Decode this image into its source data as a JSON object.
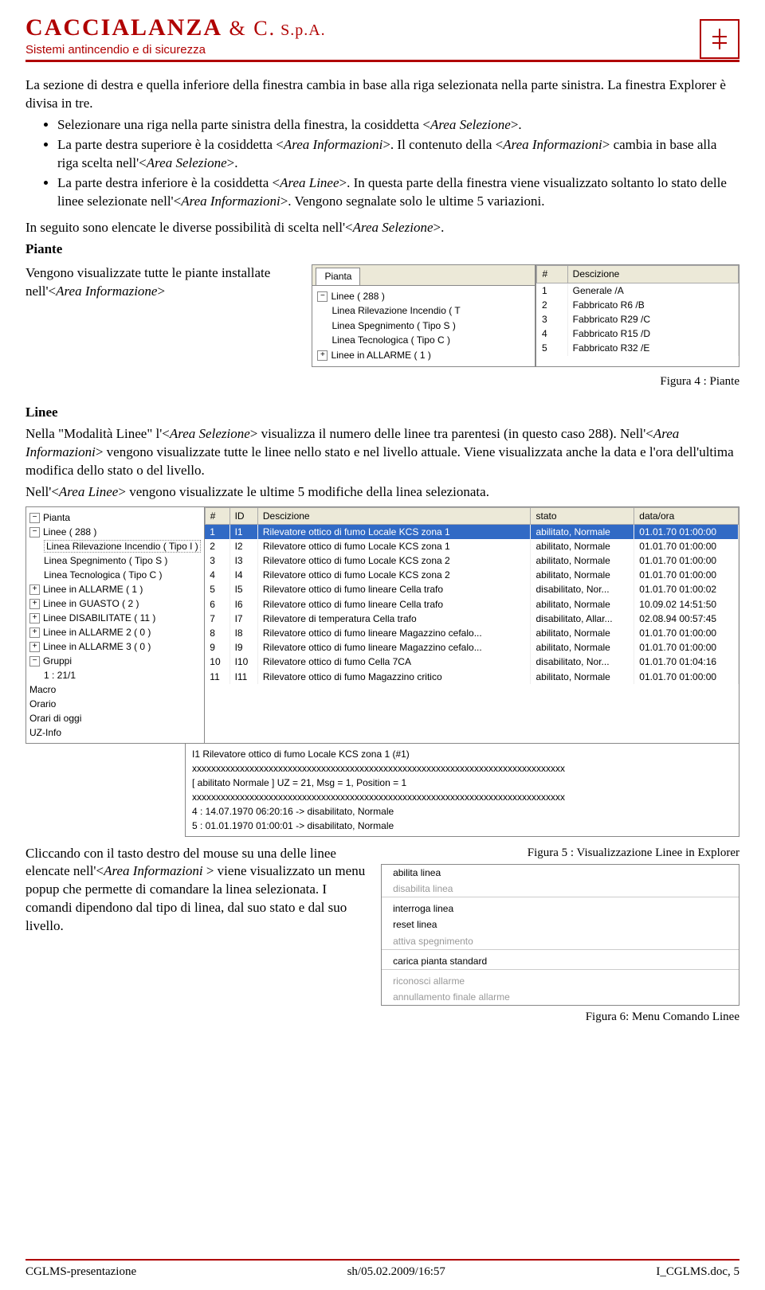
{
  "header": {
    "company": "CACCIALANZA",
    "amp": " & C.",
    "spa": " S.p.A.",
    "tagline": "Sistemi antincendio e di sicurezza",
    "logo": "⌘"
  },
  "p1": "La sezione di destra e quella inferiore della finestra cambia in base alla riga selezionata nella parte sinistra. La finestra Explorer è divisa in tre.",
  "b1a": "Selezionare una riga nella parte sinistra della finestra, la cosiddetta <",
  "b1b": "Area Selezione",
  "b1c": ">.",
  "b2a": "La parte destra superiore è la cosiddetta <",
  "b2b": "Area Informazioni",
  "b2c": ">. Il contenuto della <",
  "b2d": "Area Informazioni",
  "b2e": "> cambia in base alla riga scelta nell'<",
  "b2f": "Area Selezione",
  "b2g": ">.",
  "b3a": "La parte destra inferiore è la cosiddetta <",
  "b3b": "Area Linee",
  "b3c": ">. In questa parte della finestra viene visualizzato soltanto lo stato delle linee selezionate nell'<",
  "b3d": "Area Informazioni",
  "b3e": ">. Vengono segnalate solo le ultime 5 variazioni.",
  "p2a": "In seguito sono elencate le diverse possibilità di scelta nell'<",
  "p2b": "Area Selezione",
  "p2c": ">.",
  "piante": "Piante",
  "p3a": "Vengono visualizzate tutte le piante installate nell'<",
  "p3b": "Area Informazione",
  "p3c": ">",
  "fig4": "Figura 4 : Piante",
  "tree1": {
    "tab": "Pianta",
    "items": [
      "Linee ( 288 )",
      "Linea Rilevazione Incendio ( T",
      "Linea Spegnimento ( Tipo S )",
      "Linea Tecnologica ( Tipo C )",
      "Linee in ALLARME ( 1 )"
    ]
  },
  "tbl1": {
    "h": [
      "#",
      "Descizione"
    ],
    "r": [
      [
        "1",
        "Generale /A"
      ],
      [
        "2",
        "Fabbricato R6 /B"
      ],
      [
        "3",
        "Fabbricato R29 /C"
      ],
      [
        "4",
        "Fabbricato R15 /D"
      ],
      [
        "5",
        "Fabbricato R32 /E"
      ]
    ]
  },
  "linee": "Linee",
  "p4a": "Nella \"Modalità Linee\" l'<",
  "p4b": "Area Selezione",
  "p4c": "> visualizza il numero delle linee tra parentesi (in questo caso 288). Nell'<",
  "p4d": "Area Informazioni",
  "p4e": "> vengono visualizzate tutte le linee nello stato e nel livello attuale. Viene visualizzata anche la data e l'ora dell'ultima modifica dello stato o del livello.",
  "p5a": "Nell'<",
  "p5b": "Area Linee",
  "p5c": "> vengono visualizzate le ultime 5 modifiche della linea selezionata.",
  "tree2": [
    "Pianta",
    "Linee ( 288 )",
    "Linea Rilevazione Incendio ( Tipo I )",
    "Linea Spegnimento ( Tipo S )",
    "Linea Tecnologica ( Tipo C )",
    "Linee in ALLARME ( 1 )",
    "Linee in GUASTO ( 2 )",
    "Linee DISABILITATE ( 11 )",
    "Linee in ALLARME 2 ( 0 )",
    "Linee in ALLARME 3 ( 0 )",
    "Gruppi",
    "1 : 21/1",
    "Macro",
    "Orario",
    "Orari di oggi",
    "UZ-Info"
  ],
  "tbl2": {
    "h": [
      "#",
      "ID",
      "Descizione",
      "stato",
      "data/ora"
    ],
    "r": [
      [
        "1",
        "I1",
        "Rilevatore ottico di fumo Locale KCS zona 1",
        "abilitato, Normale",
        "01.01.70 01:00:00"
      ],
      [
        "2",
        "I2",
        "Rilevatore ottico di fumo Locale KCS zona 1",
        "abilitato, Normale",
        "01.01.70 01:00:00"
      ],
      [
        "3",
        "I3",
        "Rilevatore ottico di fumo Locale KCS zona 2",
        "abilitato, Normale",
        "01.01.70 01:00:00"
      ],
      [
        "4",
        "I4",
        "Rilevatore ottico di fumo Locale KCS zona 2",
        "abilitato, Normale",
        "01.01.70 01:00:00"
      ],
      [
        "5",
        "I5",
        "Rilevatore ottico di fumo lineare Cella trafo",
        "disabilitato, Nor...",
        "01.01.70 01:00:02"
      ],
      [
        "6",
        "I6",
        "Rilevatore ottico di fumo lineare Cella trafo",
        "abilitato, Normale",
        "10.09.02 14:51:50"
      ],
      [
        "7",
        "I7",
        "Rilevatore di temperatura Cella trafo",
        "disabilitato, Allar...",
        "02.08.94 00:57:45"
      ],
      [
        "8",
        "I8",
        "Rilevatore ottico di fumo lineare Magazzino cefalo...",
        "abilitato, Normale",
        "01.01.70 01:00:00"
      ],
      [
        "9",
        "I9",
        "Rilevatore ottico di fumo lineare Magazzino cefalo...",
        "abilitato, Normale",
        "01.01.70 01:00:00"
      ],
      [
        "10",
        "I10",
        "Rilevatore ottico di fumo Cella 7CA",
        "disabilitato, Nor...",
        "01.01.70 01:04:16"
      ],
      [
        "11",
        "I11",
        "Rilevatore ottico di fumo Magazzino critico",
        "abilitato, Normale",
        "01.01.70 01:00:00"
      ]
    ]
  },
  "det": {
    "t": "I1 Rilevatore ottico di fumo Locale KCS zona 1 (#1)",
    "sep": "xxxxxxxxxxxxxxxxxxxxxxxxxxxxxxxxxxxxxxxxxxxxxxxxxxxxxxxxxxxxxxxxxxxxxxxxxxxxxx",
    "s": "[ abilitato Normale ]   UZ = 21, Msg = 1, Position = 1",
    "l1": "4 : 14.07.1970 06:20:16   ->   disabilitato, Normale",
    "l2": "5 : 01.01.1970 01:00:01   ->   disabilitato, Normale"
  },
  "fig5": "Figura 5 : Visualizzazione Linee in Explorer",
  "p6a": "Cliccando con il tasto destro del mouse su una delle linee elencate nell'<",
  "p6b": "Area Informazioni ",
  "p6c": "> viene visualizzato un menu popup che permette di comandare la linea selezionata. I comandi dipendono dal tipo di linea, dal suo stato e dal suo livello.",
  "menu": [
    [
      "abilita linea",
      "<ENABLE>",
      "e"
    ],
    [
      "disabilita linea",
      "<DISABLE>",
      "d"
    ],
    [
      "",
      "",
      "sep"
    ],
    [
      "interroga linea",
      "<REQUEST>",
      "e"
    ],
    [
      "reset linea",
      "<RESET>",
      "e"
    ],
    [
      "attiva spegnimento",
      "<EXTINGUISH>",
      "d"
    ],
    [
      "",
      "",
      "sep"
    ],
    [
      "carica pianta standard",
      "",
      "e"
    ],
    [
      "",
      "",
      "sep"
    ],
    [
      "riconosci allarme",
      "<ACK>",
      "d"
    ],
    [
      "annullamento finale allarme",
      "<ENDACK>",
      "d"
    ]
  ],
  "fig6": "Figura 6: Menu Comando Linee",
  "footer": {
    "l": "CGLMS-presentazione",
    "c": "sh/05.02.2009/16:57",
    "r": "I_CGLMS.doc, 5"
  }
}
